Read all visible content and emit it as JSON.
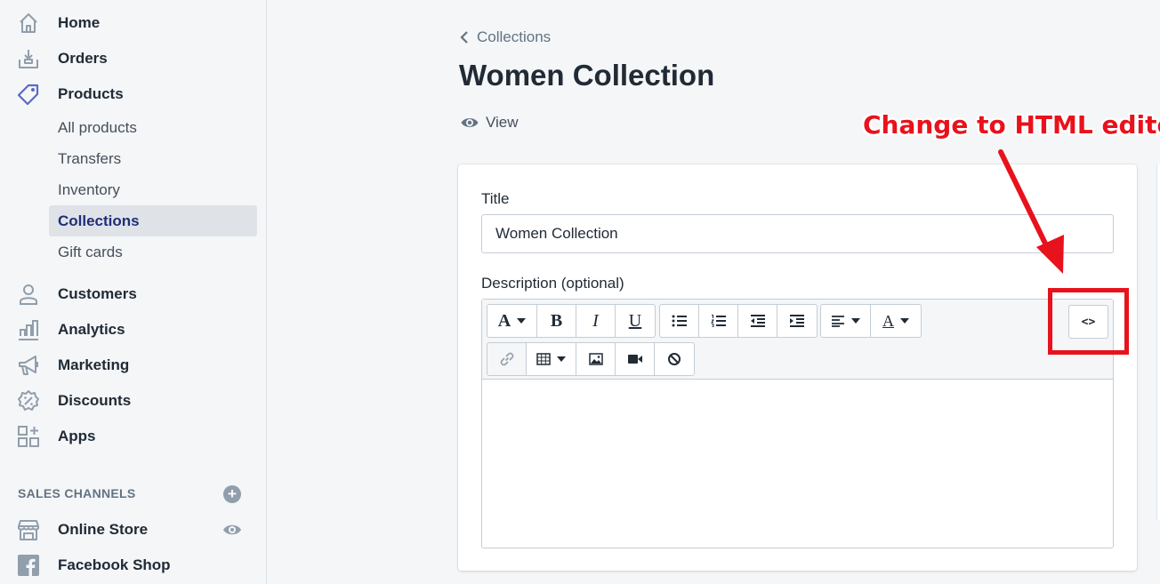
{
  "sidebar": {
    "items": [
      {
        "label": "Home",
        "icon": "home-icon"
      },
      {
        "label": "Orders",
        "icon": "orders-icon"
      },
      {
        "label": "Products",
        "icon": "tag-icon"
      }
    ],
    "product_sub": [
      {
        "label": "All products",
        "active": false
      },
      {
        "label": "Transfers",
        "active": false
      },
      {
        "label": "Inventory",
        "active": false
      },
      {
        "label": "Collections",
        "active": true
      },
      {
        "label": "Gift cards",
        "active": false
      }
    ],
    "items2": [
      {
        "label": "Customers",
        "icon": "customer-icon"
      },
      {
        "label": "Analytics",
        "icon": "analytics-icon"
      },
      {
        "label": "Marketing",
        "icon": "megaphone-icon"
      },
      {
        "label": "Discounts",
        "icon": "discount-icon"
      },
      {
        "label": "Apps",
        "icon": "apps-icon"
      }
    ],
    "sales_channels_header": "SALES CHANNELS",
    "channels": [
      {
        "label": "Online Store",
        "icon": "store-icon"
      },
      {
        "label": "Facebook Shop",
        "icon": "facebook-icon"
      }
    ]
  },
  "main": {
    "breadcrumb": "Collections",
    "title": "Women Collection",
    "view_link": "View",
    "annotation": "Change to HTML editor",
    "form": {
      "title_label": "Title",
      "title_value": "Women Collection",
      "description_label": "Description (optional)",
      "code_toggle": "<>",
      "description_value": ""
    }
  },
  "colors": {
    "accent": "#202e78",
    "annotation": "#e8121c",
    "sidebar_bg": "#f4f6f8",
    "active_bg": "#dfe3e8"
  }
}
